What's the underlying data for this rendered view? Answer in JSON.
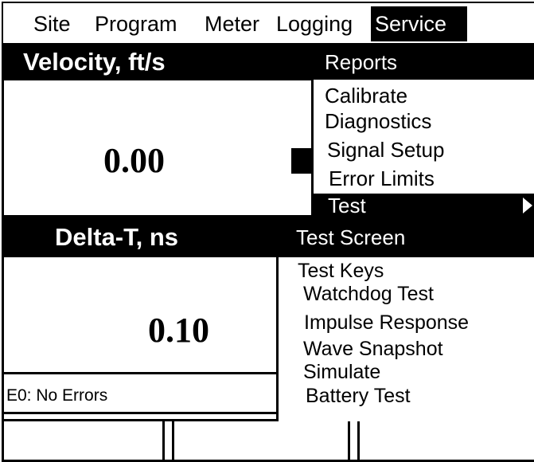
{
  "menubar": {
    "items": [
      {
        "label": "Site"
      },
      {
        "label": "Program"
      },
      {
        "label": "Meter"
      },
      {
        "label": "Logging"
      },
      {
        "label": "Service"
      }
    ]
  },
  "panel_top": {
    "title": "Velocity, ft/s",
    "value": "0.00"
  },
  "panel_bottom": {
    "title": "Delta-T, ns",
    "value": "0.10"
  },
  "status": {
    "text": "E0: No Errors"
  },
  "service_menu": {
    "items": [
      {
        "label": "Reports"
      },
      {
        "label": "Calibrate"
      },
      {
        "label": "Diagnostics"
      },
      {
        "label": "Signal Setup"
      },
      {
        "label": "Error Limits"
      },
      {
        "label": "Test"
      }
    ]
  },
  "test_submenu": {
    "items": [
      {
        "label": "Test Screen"
      },
      {
        "label": "Test Keys"
      },
      {
        "label": "Watchdog Test"
      },
      {
        "label": "Impulse Response"
      },
      {
        "label": "Wave Snapshot"
      },
      {
        "label": "Simulate"
      },
      {
        "label": "Battery Test"
      }
    ]
  },
  "icons": {
    "test_arrow": "triangle-right"
  }
}
